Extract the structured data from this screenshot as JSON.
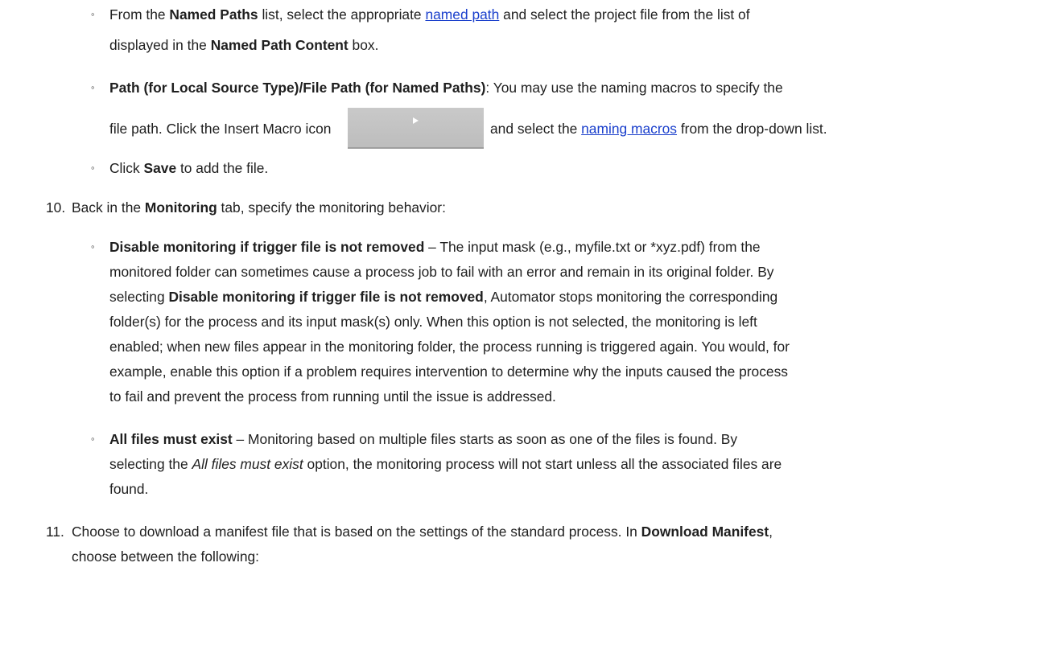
{
  "named_paths_item": {
    "p1": "From the ",
    "b1": "Named Paths",
    "p2": " list, select the appropriate ",
    "link_named_path": "named path",
    "p3": " and select the project file from the list of",
    "p4": "displayed in the ",
    "b2": "Named Path Content",
    "p5": " box."
  },
  "path_item": {
    "b1": "Path (for Local Source Type)/File Path (for Named Paths)",
    "p1": ": You may use the naming macros to specify the",
    "p2": "file path. Click the Insert Macro icon",
    "p3": "and select the ",
    "link_naming_macros": "naming macros",
    "p4": " from the drop-down list."
  },
  "save_item": {
    "p1": "Click ",
    "b1": "Save",
    "p2": " to add the file."
  },
  "step10": {
    "number": "10.",
    "p1": "Back in the ",
    "b1": "Monitoring",
    "p2": " tab, specify the monitoring behavior:"
  },
  "disable_item": {
    "b1": "Disable monitoring if trigger file is not removed",
    "p1": " – The input mask (e.g., myfile.txt or *xyz.pdf) from the",
    "l2": "monitored folder can sometimes cause a process job to fail with an error and remain in its original folder. By",
    "l3a": "selecting ",
    "b2": "Disable monitoring if trigger file is not removed",
    "l3b": ", Automator stops monitoring the corresponding",
    "l4": "folder(s) for the process and its input mask(s) only. When this option is not selected, the monitoring is left",
    "l5": "enabled; when new files appear in the monitoring folder, the process running is triggered again. You would, for",
    "l6": "example, enable this option if a problem requires intervention to determine why the inputs caused the process",
    "l7": "to fail and prevent the process from running until the issue is addressed."
  },
  "allfiles_item": {
    "b1": "All files must exist",
    "p1": " – Monitoring based on multiple files starts as soon as one of the files is found. By",
    "l2a": "selecting the ",
    "i1": "All files must exist",
    "l2b": " option, the monitoring process will not start unless all the associated files are",
    "l3": "found."
  },
  "step11": {
    "number": "11.",
    "p1": "Choose to download a manifest file that is based on the settings of the standard process. In ",
    "b1": "Download Manifest",
    "p2": ",",
    "l2": "choose between the following:"
  },
  "bullet_glyph": "◦",
  "icons": {
    "insert_macro": "play-triangle-icon"
  },
  "colors": {
    "link": "#1a3fcc",
    "text": "#1f1f1f",
    "icon_bg": "#c4c4c4"
  }
}
